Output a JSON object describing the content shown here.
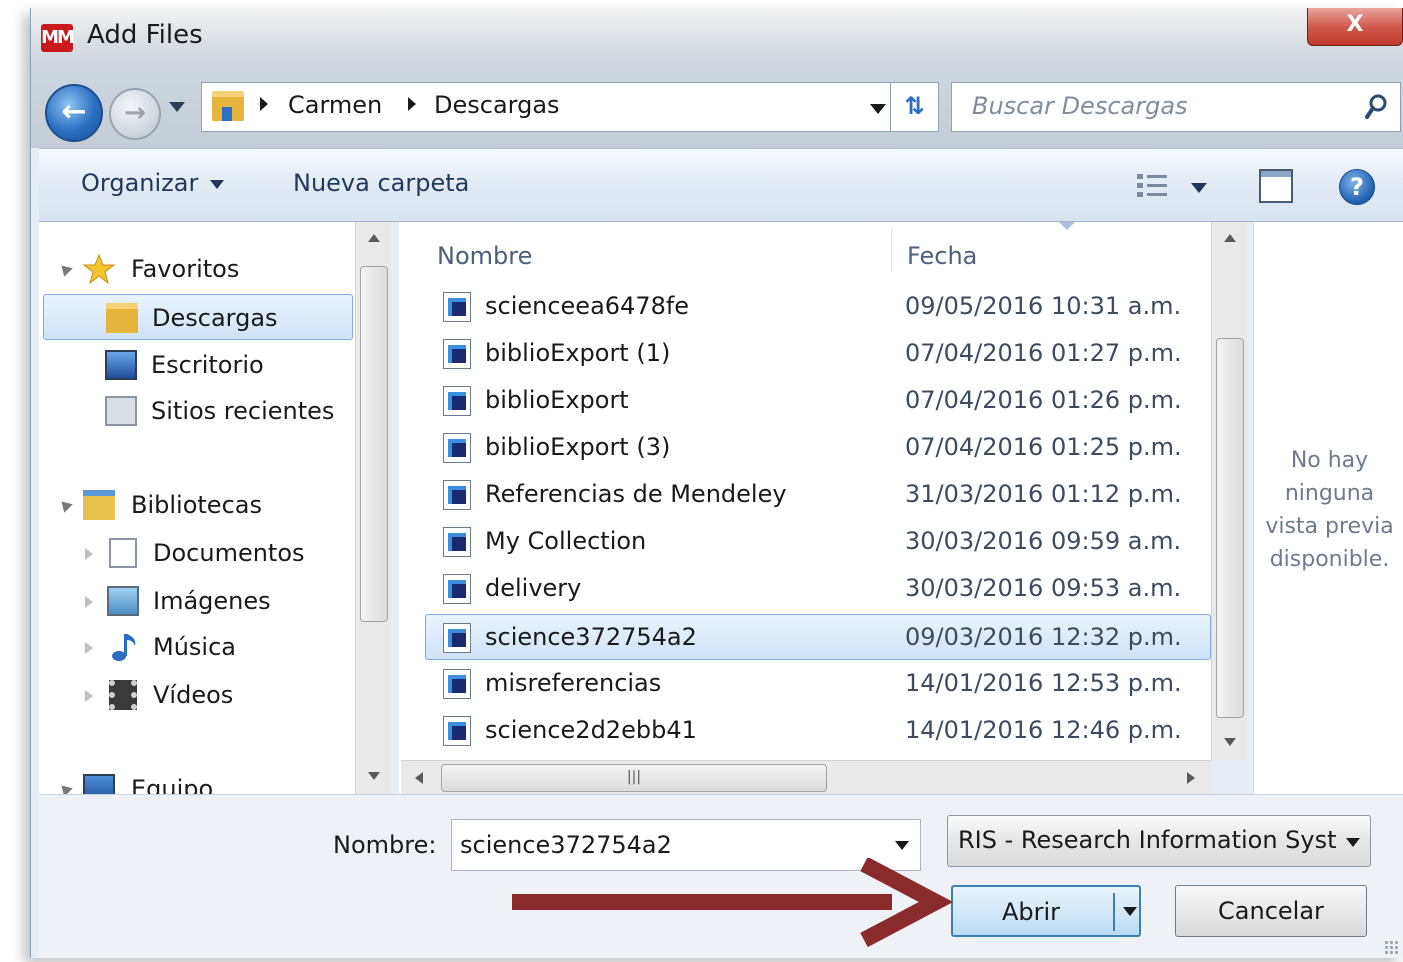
{
  "window": {
    "title": "Add Files",
    "close_label": "X"
  },
  "address": {
    "crumbs": [
      "Carmen",
      "Descargas"
    ],
    "search_placeholder": "Buscar Descargas"
  },
  "toolbar": {
    "organize": "Organizar",
    "new_folder": "Nueva carpeta"
  },
  "nav": {
    "favorites": "Favoritos",
    "downloads": "Descargas",
    "desktop": "Escritorio",
    "recent": "Sitios recientes",
    "libraries": "Bibliotecas",
    "documents": "Documentos",
    "images": "Imágenes",
    "music": "Música",
    "videos": "Vídeos",
    "computer": "Equipo"
  },
  "list": {
    "col_name": "Nombre",
    "col_date": "Fecha",
    "files": [
      {
        "name": "scienceea6478fe",
        "date": "09/05/2016 10:31 a.m."
      },
      {
        "name": "biblioExport (1)",
        "date": "07/04/2016 01:27 p.m."
      },
      {
        "name": "biblioExport",
        "date": "07/04/2016 01:26 p.m."
      },
      {
        "name": "biblioExport (3)",
        "date": "07/04/2016 01:25 p.m."
      },
      {
        "name": "Referencias de Mendeley",
        "date": "31/03/2016 01:12 p.m."
      },
      {
        "name": "My Collection",
        "date": "30/03/2016 09:59 a.m."
      },
      {
        "name": "delivery",
        "date": "30/03/2016 09:53 a.m."
      },
      {
        "name": "science372754a2",
        "date": "09/03/2016 12:32 p.m."
      },
      {
        "name": "misreferencias",
        "date": "14/01/2016 12:53 p.m."
      },
      {
        "name": "science2d2ebb41",
        "date": "14/01/2016 12:46 p.m."
      }
    ],
    "selected_index": 7
  },
  "preview": {
    "message": "No hay ninguna vista previa disponible."
  },
  "footer": {
    "name_label": "Nombre:",
    "name_value": "science372754a2",
    "file_type": "RIS - Research Information Syst",
    "open_label": "Abrir",
    "cancel_label": "Cancelar"
  },
  "colors": {
    "accent": "#3c7fb1",
    "selection": "#cfe3f8",
    "callout_arrow": "#8b2a2a"
  },
  "icons": [
    "app-logo-icon",
    "back-arrow-icon",
    "forward-arrow-icon",
    "folder-download-icon",
    "refresh-icon",
    "search-icon",
    "view-options-icon",
    "preview-pane-icon",
    "help-icon",
    "star-icon",
    "desktop-icon",
    "recent-places-icon",
    "library-icon",
    "document-icon",
    "pictures-icon",
    "music-icon",
    "video-icon",
    "computer-icon",
    "file-icon"
  ]
}
